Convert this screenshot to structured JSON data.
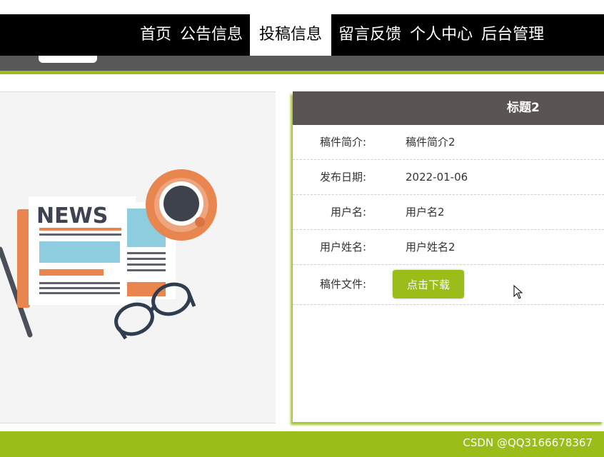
{
  "nav": {
    "items": [
      {
        "label": "首页",
        "active": false
      },
      {
        "label": "公告信息",
        "active": false
      },
      {
        "label": "投稿信息",
        "active": true
      },
      {
        "label": "留言反馈",
        "active": false
      },
      {
        "label": "个人中心",
        "active": false
      },
      {
        "label": "后台管理",
        "active": false
      }
    ]
  },
  "image": {
    "news_text": "NEWS",
    "icon": "newspaper-coffee-glasses-illustration"
  },
  "detail": {
    "title": "标题2",
    "rows": [
      {
        "label": "稿件简介:",
        "value": "稿件简介2"
      },
      {
        "label": "发布日期:",
        "value": "2022-01-06"
      },
      {
        "label": "用户名:",
        "value": "用户名2"
      },
      {
        "label": "用户姓名:",
        "value": "用户姓名2"
      }
    ],
    "file_label": "稿件文件:",
    "download_label": "点击下载"
  },
  "watermark": "CSDN @QQ3166678367",
  "colors": {
    "accent": "#9bbd1a",
    "header_dark": "#5a5452",
    "nav_bg": "#000000"
  }
}
